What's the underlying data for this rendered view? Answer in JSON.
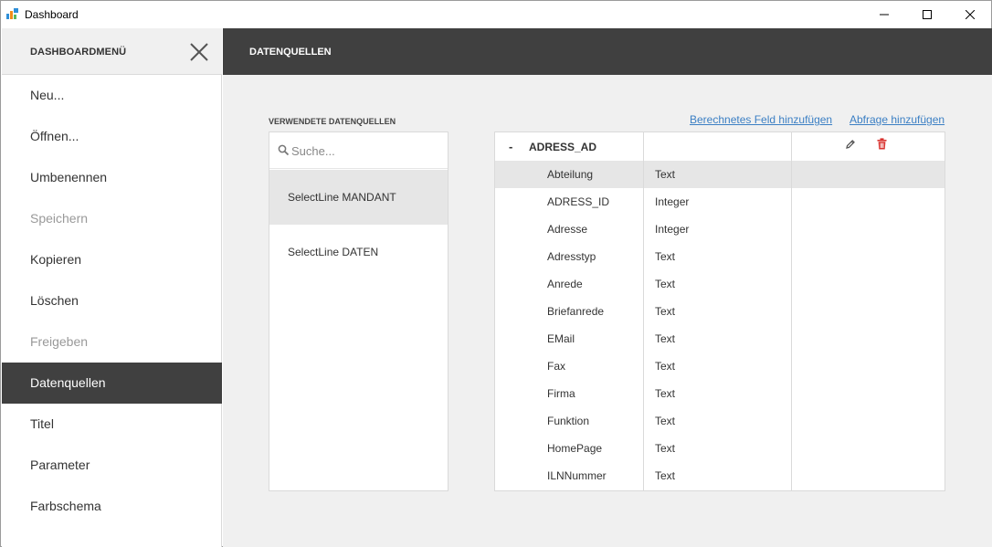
{
  "window": {
    "title": "Dashboard"
  },
  "menu": {
    "title": "DASHBOARDMENÜ",
    "items": [
      {
        "label": "Neu...",
        "state": "normal"
      },
      {
        "label": "Öffnen...",
        "state": "normal"
      },
      {
        "label": "Umbenennen",
        "state": "normal"
      },
      {
        "label": "Speichern",
        "state": "disabled"
      },
      {
        "label": "Kopieren",
        "state": "normal"
      },
      {
        "label": "Löschen",
        "state": "normal"
      },
      {
        "label": "Freigeben",
        "state": "disabled"
      },
      {
        "label": "Datenquellen",
        "state": "active"
      },
      {
        "label": "Titel",
        "state": "normal"
      },
      {
        "label": "Parameter",
        "state": "normal"
      },
      {
        "label": "Farbschema",
        "state": "normal"
      }
    ]
  },
  "main": {
    "title": "DATENQUELLEN",
    "sources_label": "VERWENDETE DATENQUELLEN",
    "search": {
      "placeholder": "Suche...",
      "value": ""
    },
    "sources": [
      {
        "label": "SelectLine MANDANT",
        "selected": true
      },
      {
        "label": "SelectLine DATEN",
        "selected": false
      }
    ],
    "links": {
      "add_calculated_field": "Berechnetes Feld hinzufügen",
      "add_query": "Abfrage hinzufügen"
    },
    "table": {
      "toggle": "-",
      "name": "ADRESS_AD",
      "fields": [
        {
          "name": "Abteilung",
          "type": "Text",
          "selected": true
        },
        {
          "name": "ADRESS_ID",
          "type": "Integer",
          "selected": false
        },
        {
          "name": "Adresse",
          "type": "Integer",
          "selected": false
        },
        {
          "name": "Adresstyp",
          "type": "Text",
          "selected": false
        },
        {
          "name": "Anrede",
          "type": "Text",
          "selected": false
        },
        {
          "name": "Briefanrede",
          "type": "Text",
          "selected": false
        },
        {
          "name": "EMail",
          "type": "Text",
          "selected": false
        },
        {
          "name": "Fax",
          "type": "Text",
          "selected": false
        },
        {
          "name": "Firma",
          "type": "Text",
          "selected": false
        },
        {
          "name": "Funktion",
          "type": "Text",
          "selected": false
        },
        {
          "name": "HomePage",
          "type": "Text",
          "selected": false
        },
        {
          "name": "ILNNummer",
          "type": "Text",
          "selected": false
        }
      ]
    }
  },
  "colors": {
    "accent_dark": "#404040",
    "link": "#3b7fc4",
    "delete": "#d9322f",
    "selection": "#e6e6e6"
  }
}
